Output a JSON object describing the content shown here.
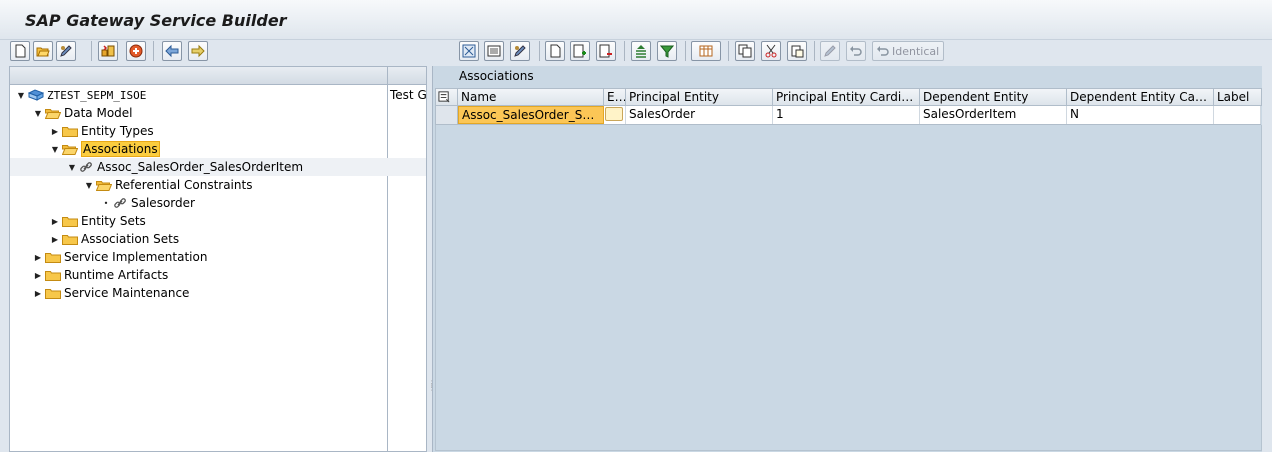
{
  "app": {
    "title": "SAP Gateway Service Builder"
  },
  "left_toolbar": [
    {
      "name": "create-icon"
    },
    {
      "name": "open-icon"
    },
    {
      "name": "edit-icon"
    },
    {
      "name": "generate-icon"
    },
    {
      "name": "check-icon"
    },
    {
      "name": "back-icon"
    },
    {
      "name": "forward-icon"
    }
  ],
  "tree": {
    "column2_header": "Test G",
    "nodes": [
      {
        "label": "ZTEST_SEPM_ISOE",
        "level": 0,
        "twisty": "open",
        "icon": "project-icon"
      },
      {
        "label": "Data Model",
        "level": 1,
        "twisty": "open",
        "icon": "folder-open-icon"
      },
      {
        "label": "Entity Types",
        "level": 2,
        "twisty": "closed",
        "icon": "folder-icon"
      },
      {
        "label": "Associations",
        "level": 2,
        "twisty": "open",
        "icon": "folder-open-icon",
        "highlighted": true
      },
      {
        "label": "Assoc_SalesOrder_SalesOrderItem",
        "level": 3,
        "twisty": "open",
        "icon": "link-icon",
        "selected": true
      },
      {
        "label": "Referential Constraints",
        "level": 4,
        "twisty": "open",
        "icon": "folder-open-icon"
      },
      {
        "label": "Salesorder",
        "level": 5,
        "twisty": "leaf",
        "icon": "link-icon"
      },
      {
        "label": "Entity Sets",
        "level": 2,
        "twisty": "closed",
        "icon": "folder-icon"
      },
      {
        "label": "Association Sets",
        "level": 2,
        "twisty": "closed",
        "icon": "folder-icon"
      },
      {
        "label": "Service Implementation",
        "level": 1,
        "twisty": "closed",
        "icon": "folder-icon"
      },
      {
        "label": "Runtime Artifacts",
        "level": 1,
        "twisty": "closed",
        "icon": "folder-icon"
      },
      {
        "label": "Service Maintenance",
        "level": 1,
        "twisty": "closed",
        "icon": "folder-icon"
      }
    ]
  },
  "right_toolbar": {
    "identical_label": "Identical"
  },
  "associations": {
    "title": "Associations",
    "columns": [
      "Name",
      "E...",
      "Principal Entity",
      "Principal Entity Cardinality",
      "Dependent Entity",
      "Dependent Entity Cardin...",
      "Label"
    ],
    "rows": [
      [
        "Assoc_SalesOrder_Sales...",
        "",
        "SalesOrder",
        "1",
        "SalesOrderItem",
        "N",
        ""
      ]
    ]
  },
  "colors": {
    "title_bg": "#dfe6ed",
    "selected_cell": "#fbc656",
    "panel_bg": "#cad8e4"
  }
}
